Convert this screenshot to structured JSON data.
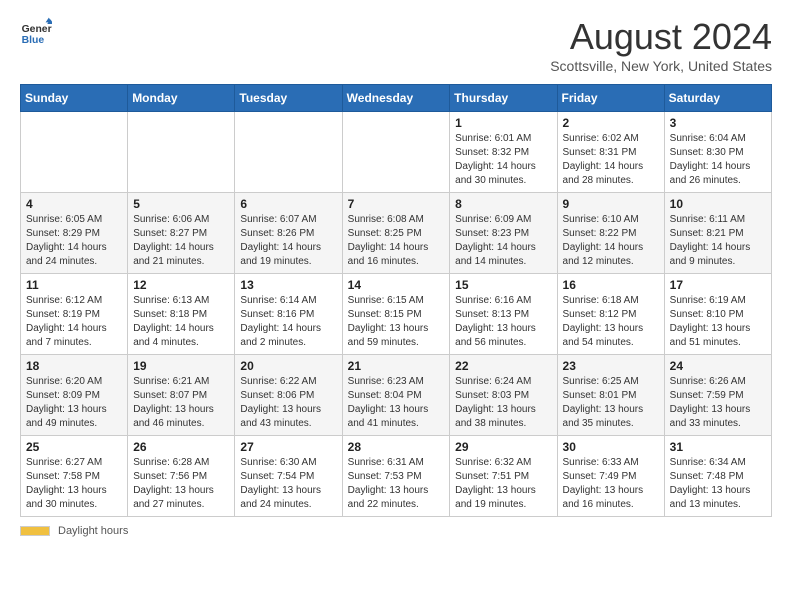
{
  "header": {
    "logo_general": "General",
    "logo_blue": "Blue",
    "title": "August 2024",
    "subtitle": "Scottsville, New York, United States"
  },
  "days_of_week": [
    "Sunday",
    "Monday",
    "Tuesday",
    "Wednesday",
    "Thursday",
    "Friday",
    "Saturday"
  ],
  "weeks": [
    [
      {
        "day": "",
        "sunrise": "",
        "sunset": "",
        "daylight": ""
      },
      {
        "day": "",
        "sunrise": "",
        "sunset": "",
        "daylight": ""
      },
      {
        "day": "",
        "sunrise": "",
        "sunset": "",
        "daylight": ""
      },
      {
        "day": "",
        "sunrise": "",
        "sunset": "",
        "daylight": ""
      },
      {
        "day": "1",
        "sunrise": "Sunrise: 6:01 AM",
        "sunset": "Sunset: 8:32 PM",
        "daylight": "Daylight: 14 hours and 30 minutes."
      },
      {
        "day": "2",
        "sunrise": "Sunrise: 6:02 AM",
        "sunset": "Sunset: 8:31 PM",
        "daylight": "Daylight: 14 hours and 28 minutes."
      },
      {
        "day": "3",
        "sunrise": "Sunrise: 6:04 AM",
        "sunset": "Sunset: 8:30 PM",
        "daylight": "Daylight: 14 hours and 26 minutes."
      }
    ],
    [
      {
        "day": "4",
        "sunrise": "Sunrise: 6:05 AM",
        "sunset": "Sunset: 8:29 PM",
        "daylight": "Daylight: 14 hours and 24 minutes."
      },
      {
        "day": "5",
        "sunrise": "Sunrise: 6:06 AM",
        "sunset": "Sunset: 8:27 PM",
        "daylight": "Daylight: 14 hours and 21 minutes."
      },
      {
        "day": "6",
        "sunrise": "Sunrise: 6:07 AM",
        "sunset": "Sunset: 8:26 PM",
        "daylight": "Daylight: 14 hours and 19 minutes."
      },
      {
        "day": "7",
        "sunrise": "Sunrise: 6:08 AM",
        "sunset": "Sunset: 8:25 PM",
        "daylight": "Daylight: 14 hours and 16 minutes."
      },
      {
        "day": "8",
        "sunrise": "Sunrise: 6:09 AM",
        "sunset": "Sunset: 8:23 PM",
        "daylight": "Daylight: 14 hours and 14 minutes."
      },
      {
        "day": "9",
        "sunrise": "Sunrise: 6:10 AM",
        "sunset": "Sunset: 8:22 PM",
        "daylight": "Daylight: 14 hours and 12 minutes."
      },
      {
        "day": "10",
        "sunrise": "Sunrise: 6:11 AM",
        "sunset": "Sunset: 8:21 PM",
        "daylight": "Daylight: 14 hours and 9 minutes."
      }
    ],
    [
      {
        "day": "11",
        "sunrise": "Sunrise: 6:12 AM",
        "sunset": "Sunset: 8:19 PM",
        "daylight": "Daylight: 14 hours and 7 minutes."
      },
      {
        "day": "12",
        "sunrise": "Sunrise: 6:13 AM",
        "sunset": "Sunset: 8:18 PM",
        "daylight": "Daylight: 14 hours and 4 minutes."
      },
      {
        "day": "13",
        "sunrise": "Sunrise: 6:14 AM",
        "sunset": "Sunset: 8:16 PM",
        "daylight": "Daylight: 14 hours and 2 minutes."
      },
      {
        "day": "14",
        "sunrise": "Sunrise: 6:15 AM",
        "sunset": "Sunset: 8:15 PM",
        "daylight": "Daylight: 13 hours and 59 minutes."
      },
      {
        "day": "15",
        "sunrise": "Sunrise: 6:16 AM",
        "sunset": "Sunset: 8:13 PM",
        "daylight": "Daylight: 13 hours and 56 minutes."
      },
      {
        "day": "16",
        "sunrise": "Sunrise: 6:18 AM",
        "sunset": "Sunset: 8:12 PM",
        "daylight": "Daylight: 13 hours and 54 minutes."
      },
      {
        "day": "17",
        "sunrise": "Sunrise: 6:19 AM",
        "sunset": "Sunset: 8:10 PM",
        "daylight": "Daylight: 13 hours and 51 minutes."
      }
    ],
    [
      {
        "day": "18",
        "sunrise": "Sunrise: 6:20 AM",
        "sunset": "Sunset: 8:09 PM",
        "daylight": "Daylight: 13 hours and 49 minutes."
      },
      {
        "day": "19",
        "sunrise": "Sunrise: 6:21 AM",
        "sunset": "Sunset: 8:07 PM",
        "daylight": "Daylight: 13 hours and 46 minutes."
      },
      {
        "day": "20",
        "sunrise": "Sunrise: 6:22 AM",
        "sunset": "Sunset: 8:06 PM",
        "daylight": "Daylight: 13 hours and 43 minutes."
      },
      {
        "day": "21",
        "sunrise": "Sunrise: 6:23 AM",
        "sunset": "Sunset: 8:04 PM",
        "daylight": "Daylight: 13 hours and 41 minutes."
      },
      {
        "day": "22",
        "sunrise": "Sunrise: 6:24 AM",
        "sunset": "Sunset: 8:03 PM",
        "daylight": "Daylight: 13 hours and 38 minutes."
      },
      {
        "day": "23",
        "sunrise": "Sunrise: 6:25 AM",
        "sunset": "Sunset: 8:01 PM",
        "daylight": "Daylight: 13 hours and 35 minutes."
      },
      {
        "day": "24",
        "sunrise": "Sunrise: 6:26 AM",
        "sunset": "Sunset: 7:59 PM",
        "daylight": "Daylight: 13 hours and 33 minutes."
      }
    ],
    [
      {
        "day": "25",
        "sunrise": "Sunrise: 6:27 AM",
        "sunset": "Sunset: 7:58 PM",
        "daylight": "Daylight: 13 hours and 30 minutes."
      },
      {
        "day": "26",
        "sunrise": "Sunrise: 6:28 AM",
        "sunset": "Sunset: 7:56 PM",
        "daylight": "Daylight: 13 hours and 27 minutes."
      },
      {
        "day": "27",
        "sunrise": "Sunrise: 6:30 AM",
        "sunset": "Sunset: 7:54 PM",
        "daylight": "Daylight: 13 hours and 24 minutes."
      },
      {
        "day": "28",
        "sunrise": "Sunrise: 6:31 AM",
        "sunset": "Sunset: 7:53 PM",
        "daylight": "Daylight: 13 hours and 22 minutes."
      },
      {
        "day": "29",
        "sunrise": "Sunrise: 6:32 AM",
        "sunset": "Sunset: 7:51 PM",
        "daylight": "Daylight: 13 hours and 19 minutes."
      },
      {
        "day": "30",
        "sunrise": "Sunrise: 6:33 AM",
        "sunset": "Sunset: 7:49 PM",
        "daylight": "Daylight: 13 hours and 16 minutes."
      },
      {
        "day": "31",
        "sunrise": "Sunrise: 6:34 AM",
        "sunset": "Sunset: 7:48 PM",
        "daylight": "Daylight: 13 hours and 13 minutes."
      }
    ]
  ],
  "footer": {
    "daylight_label": "Daylight hours"
  }
}
